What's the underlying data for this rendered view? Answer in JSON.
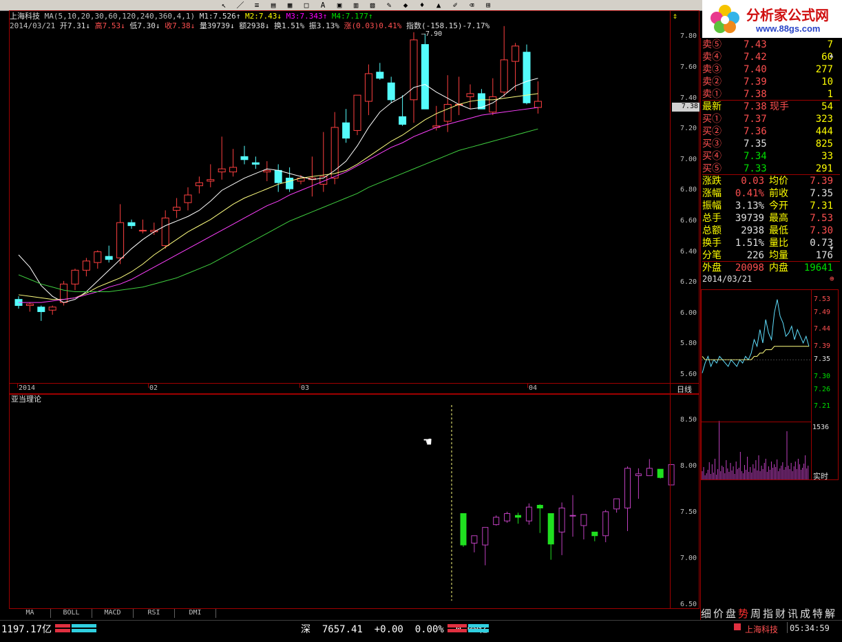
{
  "toolbar": {
    "icons": [
      "cursor-icon",
      "pen-icon",
      "line-icon",
      "channel-icon",
      "text-icon",
      "rect-icon",
      "tools-icon",
      "save-icon"
    ],
    "glyphs": [
      "↖",
      "／",
      "≡",
      "▤",
      "▦",
      "□",
      "A",
      "▣",
      "▥",
      "▧",
      "✎",
      "◆",
      "♦",
      "▲",
      "✐",
      "⌫",
      "⊞"
    ]
  },
  "header": {
    "line1": [
      {
        "text": "上海科技",
        "color": "#e0e0e0"
      },
      {
        "text": " MA(5,10,20,30,60,120,240,360,4,1)",
        "color": "#c0c0c0"
      },
      {
        "text": " M1:7.526↑",
        "color": "#e0e0e0"
      },
      {
        "text": " M2:7.43↓",
        "color": "#ffff00"
      },
      {
        "text": " M3:7.343↑",
        "color": "#ff00ff"
      },
      {
        "text": " M4:7.177↑",
        "color": "#00e000"
      }
    ],
    "line2": [
      {
        "text": "2014/03/21",
        "color": "#c0c0c0"
      },
      {
        "text": " 开7.31↓",
        "color": "#e0e0e0"
      },
      {
        "text": " 高7.53↓",
        "color": "#ff5050"
      },
      {
        "text": " 低7.30↓",
        "color": "#e0e0e0"
      },
      {
        "text": " 收7.38↓",
        "color": "#ff5050"
      },
      {
        "text": " 量39739↓",
        "color": "#e0e0e0"
      },
      {
        "text": " 额2938↓",
        "color": "#e0e0e0"
      },
      {
        "text": " 换1.51%",
        "color": "#e0e0e0"
      },
      {
        "text": " 振3.13%",
        "color": "#e0e0e0"
      },
      {
        "text": " 涨(0.03)0.41%",
        "color": "#ff5050"
      },
      {
        "text": " 指数(-158.15)-7.17%",
        "color": "#e0e0e0"
      }
    ],
    "peak_label": "7.90"
  },
  "main_axis": {
    "ticks": [
      "7.80",
      "7.60",
      "7.40",
      "7.20",
      "7.00",
      "6.80",
      "6.60",
      "6.40",
      "6.20",
      "6.00",
      "5.80",
      "5.60"
    ],
    "current_price": "7.38"
  },
  "date_axis": {
    "labels": [
      "2014",
      "02",
      "03",
      "04"
    ],
    "period": "日线"
  },
  "indicator": {
    "title": "亚当理论",
    "ticks": [
      "8.50",
      "8.00",
      "7.50",
      "7.00",
      "6.50"
    ]
  },
  "tabs": [
    "MA",
    "BOLL",
    "MACD",
    "RSI",
    "DMI"
  ],
  "logo": {
    "name": "分析家公式网",
    "url": "www.88gs.com"
  },
  "quote": {
    "sell": [
      {
        "label": "卖⑤",
        "price": "7.43",
        "vol": "7"
      },
      {
        "label": "卖④",
        "price": "7.42",
        "vol": "60"
      },
      {
        "label": "卖③",
        "price": "7.40",
        "vol": "277"
      },
      {
        "label": "卖②",
        "price": "7.39",
        "vol": "10"
      },
      {
        "label": "卖①",
        "price": "7.38",
        "vol": "1"
      }
    ],
    "latest": {
      "label": "最新",
      "price": "7.38",
      "label2": "现手",
      "vol": "54"
    },
    "buy": [
      {
        "label": "买①",
        "price": "7.37",
        "vol": "323"
      },
      {
        "label": "买②",
        "price": "7.36",
        "vol": "444"
      },
      {
        "label": "买③",
        "price": "7.35",
        "vol": "825"
      },
      {
        "label": "买④",
        "price": "7.34",
        "vol": "33"
      },
      {
        "label": "买⑤",
        "price": "7.33",
        "vol": "291"
      }
    ],
    "stats": [
      {
        "l1": "涨跌",
        "v1": "0.03",
        "c1": "#ff5050",
        "l2": "均价",
        "v2": "7.39",
        "c2": "#ff5050"
      },
      {
        "l1": "涨幅",
        "v1": "0.41%",
        "c1": "#ff5050",
        "l2": "前收",
        "v2": "7.35",
        "c2": "#e0e0e0"
      },
      {
        "l1": "振幅",
        "v1": "3.13%",
        "c1": "#e0e0e0",
        "l2": "今开",
        "v2": "7.31",
        "c2": "#ffff00"
      },
      {
        "l1": "总手",
        "v1": "39739",
        "c1": "#e0e0e0",
        "l2": "最高",
        "v2": "7.53",
        "c2": "#ff5050"
      },
      {
        "l1": "总额",
        "v1": "2938",
        "c1": "#e0e0e0",
        "l2": "最低",
        "v2": "7.30",
        "c2": "#ff5050"
      },
      {
        "l1": "换手",
        "v1": "1.51%",
        "c1": "#e0e0e0",
        "l2": "量比",
        "v2": "0.73",
        "c2": "#e0e0e0"
      },
      {
        "l1": "分笔",
        "v1": "226",
        "c1": "#e0e0e0",
        "l2": "均量",
        "v2": "176",
        "c2": "#e0e0e0"
      }
    ],
    "outer": {
      "l1": "外盘",
      "v1": "20098",
      "l2": "内盘",
      "v2": "19641"
    }
  },
  "mini": {
    "date": "2014/03/21",
    "ticks": [
      "7.53",
      "7.49",
      "7.44",
      "7.39",
      "7.35",
      "7.30",
      "7.26",
      "7.21"
    ],
    "vol_label": "1536",
    "realtime": "实时"
  },
  "bottom_tabs": [
    "细",
    "价",
    "盘",
    "势",
    "周",
    "指",
    "财",
    "讯",
    "成",
    "特",
    "解"
  ],
  "status": {
    "sh": "1197.17亿",
    "sz": "深  7657.41  +0.00  0.00%  0.00亿",
    "stock": "上海科技",
    "time": "05:34:59"
  },
  "chart_data": [
    {
      "type": "candlestick",
      "title": "上海科技 日线",
      "ylim": [
        5.55,
        7.95
      ],
      "candles": [
        [
          6.09,
          6.11,
          6.03,
          6.05
        ],
        [
          6.05,
          6.07,
          6.01,
          6.06
        ],
        [
          6.04,
          6.05,
          5.95,
          6.01
        ],
        [
          6.02,
          6.05,
          5.99,
          6.04
        ],
        [
          6.07,
          6.21,
          6.05,
          6.19
        ],
        [
          6.19,
          6.29,
          6.15,
          6.28
        ],
        [
          6.28,
          6.36,
          6.24,
          6.34
        ],
        [
          6.33,
          6.41,
          6.29,
          6.4
        ],
        [
          6.37,
          6.44,
          6.33,
          6.35
        ],
        [
          6.36,
          6.71,
          6.32,
          6.59
        ],
        [
          6.59,
          6.61,
          6.55,
          6.57
        ],
        [
          6.54,
          6.61,
          6.52,
          6.54
        ],
        [
          6.53,
          6.59,
          6.51,
          6.54
        ],
        [
          6.44,
          6.67,
          6.42,
          6.62
        ],
        [
          6.67,
          6.75,
          6.62,
          6.69
        ],
        [
          6.72,
          6.82,
          6.67,
          6.77
        ],
        [
          6.83,
          6.89,
          6.78,
          6.85
        ],
        [
          6.86,
          6.97,
          6.82,
          6.87
        ],
        [
          6.92,
          7.15,
          6.87,
          6.94
        ],
        [
          6.92,
          7.07,
          6.89,
          6.95
        ],
        [
          7.02,
          7.09,
          6.97,
          7.0
        ],
        [
          6.98,
          7.02,
          6.94,
          6.97
        ],
        [
          6.92,
          6.99,
          6.86,
          6.93
        ],
        [
          6.93,
          6.97,
          6.79,
          6.85
        ],
        [
          6.88,
          6.95,
          6.79,
          6.81
        ],
        [
          6.86,
          6.9,
          6.84,
          6.88
        ],
        [
          6.87,
          7.02,
          6.76,
          6.88
        ],
        [
          6.84,
          7.18,
          6.79,
          6.89
        ],
        [
          6.88,
          7.31,
          6.84,
          7.21
        ],
        [
          7.24,
          7.33,
          7.11,
          7.14
        ],
        [
          7.19,
          7.42,
          7.16,
          7.42
        ],
        [
          7.38,
          7.62,
          7.29,
          7.56
        ],
        [
          7.57,
          7.63,
          7.52,
          7.53
        ],
        [
          7.5,
          7.54,
          7.37,
          7.39
        ],
        [
          7.28,
          7.42,
          7.22,
          7.23
        ],
        [
          7.39,
          7.83,
          7.24,
          7.78
        ],
        [
          7.75,
          7.82,
          7.33,
          7.33
        ],
        [
          7.21,
          7.35,
          7.19,
          7.22
        ],
        [
          7.25,
          7.55,
          7.18,
          7.36
        ],
        [
          7.36,
          7.54,
          7.29,
          7.36
        ],
        [
          7.41,
          7.49,
          7.33,
          7.43
        ],
        [
          7.43,
          7.46,
          7.33,
          7.33
        ],
        [
          7.31,
          7.53,
          7.29,
          7.41
        ],
        [
          7.44,
          7.87,
          7.41,
          7.65
        ],
        [
          7.64,
          7.76,
          7.45,
          7.74
        ],
        [
          7.7,
          7.75,
          7.36,
          7.37
        ],
        [
          7.34,
          7.51,
          7.3,
          7.38
        ]
      ],
      "series": [
        {
          "name": "M1",
          "color": "#ffffff",
          "values": [
            6.38,
            6.3,
            6.18,
            6.11,
            6.07,
            6.09,
            6.14,
            6.21,
            6.28,
            6.35,
            6.42,
            6.48,
            6.53,
            6.57,
            6.6,
            6.63,
            6.67,
            6.73,
            6.8,
            6.84,
            6.88,
            6.91,
            6.94,
            6.93,
            6.91,
            6.89,
            6.87,
            6.88,
            6.93,
            6.99,
            7.09,
            7.21,
            7.31,
            7.37,
            7.41,
            7.47,
            7.49,
            7.44,
            7.4,
            7.36,
            7.33,
            7.34,
            7.37,
            7.42,
            7.48,
            7.51,
            7.53
          ]
        },
        {
          "name": "M2",
          "color": "#ffff80",
          "values": [
            6.12,
            6.11,
            6.1,
            6.09,
            6.09,
            6.1,
            6.13,
            6.17,
            6.2,
            6.23,
            6.27,
            6.32,
            6.38,
            6.43,
            6.48,
            6.53,
            6.57,
            6.61,
            6.66,
            6.71,
            6.75,
            6.78,
            6.81,
            6.84,
            6.86,
            6.88,
            6.89,
            6.9,
            6.91,
            6.93,
            6.97,
            7.02,
            7.07,
            7.12,
            7.16,
            7.21,
            7.26,
            7.3,
            7.33,
            7.36,
            7.38,
            7.39,
            7.39,
            7.4,
            7.41,
            7.42,
            7.43
          ]
        },
        {
          "name": "M3",
          "color": "#ff40ff",
          "values": [
            6.07,
            6.07,
            6.07,
            6.08,
            6.09,
            6.1,
            6.12,
            6.14,
            6.17,
            6.19,
            6.22,
            6.26,
            6.3,
            6.34,
            6.38,
            6.42,
            6.46,
            6.5,
            6.54,
            6.58,
            6.62,
            6.66,
            6.7,
            6.73,
            6.77,
            6.8,
            6.83,
            6.86,
            6.89,
            6.92,
            6.96,
            7.0,
            7.04,
            7.08,
            7.11,
            7.15,
            7.18,
            7.21,
            7.23,
            7.25,
            7.27,
            7.29,
            7.3,
            7.31,
            7.32,
            7.33,
            7.34
          ]
        },
        {
          "name": "M4",
          "color": "#40d040",
          "values": [
            6.25,
            6.22,
            6.19,
            6.17,
            6.15,
            6.14,
            6.14,
            6.14,
            6.14,
            6.15,
            6.16,
            6.17,
            6.19,
            6.21,
            6.23,
            6.26,
            6.29,
            6.32,
            6.36,
            6.4,
            6.44,
            6.48,
            6.52,
            6.56,
            6.6,
            6.63,
            6.66,
            6.69,
            6.72,
            6.75,
            6.78,
            6.82,
            6.85,
            6.88,
            6.91,
            6.94,
            6.97,
            7.0,
            7.03,
            7.06,
            7.08,
            7.1,
            7.12,
            7.14,
            7.16,
            7.18,
            7.2
          ]
        }
      ]
    },
    {
      "type": "candlestick",
      "title": "亚当理论",
      "ylim": [
        6.45,
        8.65
      ],
      "candles": [
        [
          7.49,
          7.49,
          7.13,
          7.15
        ],
        [
          7.17,
          7.25,
          7.07,
          7.25
        ],
        [
          7.15,
          7.34,
          6.93,
          7.34
        ],
        [
          7.37,
          7.47,
          7.36,
          7.45
        ],
        [
          7.41,
          7.51,
          7.39,
          7.49
        ],
        [
          7.47,
          7.5,
          7.38,
          7.45
        ],
        [
          7.41,
          7.6,
          7.37,
          7.56
        ],
        [
          7.58,
          7.59,
          7.28,
          7.55
        ],
        [
          7.49,
          7.49,
          6.99,
          7.16
        ],
        [
          7.29,
          7.61,
          7.04,
          7.55
        ],
        [
          7.47,
          7.69,
          7.24,
          7.47
        ],
        [
          7.36,
          7.48,
          7.21,
          7.48
        ],
        [
          7.29,
          7.29,
          7.19,
          7.25
        ],
        [
          7.25,
          7.53,
          7.18,
          7.51
        ],
        [
          7.54,
          7.65,
          7.5,
          7.65
        ],
        [
          7.55,
          8.0,
          7.3,
          7.98
        ],
        [
          7.9,
          7.98,
          7.65,
          7.92
        ],
        [
          7.9,
          8.08,
          7.92,
          7.98
        ],
        [
          7.97,
          7.97,
          7.87,
          7.88
        ],
        [
          7.8,
          8.02,
          7.84,
          8.02
        ]
      ]
    },
    {
      "type": "line",
      "title": "2014/03/21 分时",
      "ylim": [
        7.19,
        7.55
      ],
      "series": [
        {
          "name": "price",
          "color": "#60e0ff",
          "values": [
            7.31,
            7.34,
            7.36,
            7.33,
            7.35,
            7.34,
            7.36,
            7.35,
            7.34,
            7.33,
            7.35,
            7.34,
            7.33,
            7.35,
            7.34,
            7.36,
            7.35,
            7.37,
            7.41,
            7.39,
            7.44,
            7.4,
            7.47,
            7.43,
            7.41,
            7.49,
            7.53,
            7.48,
            7.46,
            7.42,
            7.43,
            7.45,
            7.41,
            7.44,
            7.42,
            7.4,
            7.42,
            7.39
          ]
        },
        {
          "name": "avg",
          "color": "#ffff80",
          "values": [
            7.36,
            7.35,
            7.35,
            7.35,
            7.35,
            7.35,
            7.35,
            7.35,
            7.35,
            7.35,
            7.35,
            7.35,
            7.35,
            7.35,
            7.35,
            7.35,
            7.35,
            7.35,
            7.36,
            7.36,
            7.37,
            7.37,
            7.38,
            7.38,
            7.38,
            7.39,
            7.39,
            7.39,
            7.39,
            7.39,
            7.39,
            7.39,
            7.39,
            7.39,
            7.39,
            7.39,
            7.39,
            7.39
          ]
        }
      ]
    }
  ]
}
